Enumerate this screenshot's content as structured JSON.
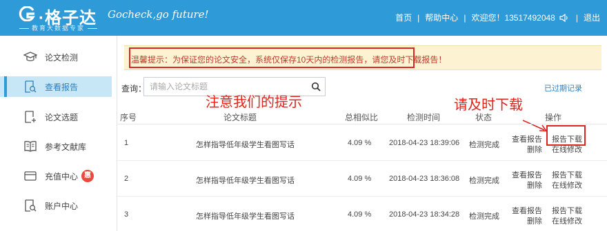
{
  "header": {
    "logo_text": "·格子达",
    "logo_subtitle": "教育大数据专家",
    "slogan": "Gocheck,go future!",
    "nav": {
      "home": "首页",
      "help": "帮助中心",
      "welcome": "欢迎您！13517492048",
      "logout": "退出"
    }
  },
  "sidebar": {
    "items": [
      {
        "label": "论文检测",
        "icon": "mortarboard-icon"
      },
      {
        "label": "查看报告",
        "icon": "report-search-icon",
        "active": true
      },
      {
        "label": "论文选题",
        "icon": "add-document-icon"
      },
      {
        "label": "参考文献库",
        "icon": "open-book-icon"
      },
      {
        "label": "充值中心",
        "icon": "card-icon",
        "badge": "惠"
      },
      {
        "label": "账户中心",
        "icon": "account-search-icon"
      }
    ]
  },
  "notice": {
    "text": "温馨提示：为保证您的论文安全，系统仅保存10天内的检测报告，请您及时下载报告！"
  },
  "search": {
    "label": "查询：",
    "placeholder": "请输入论文标题"
  },
  "expired_link": "已过期记录",
  "annotations": {
    "notice_hint": "注意我们的提示",
    "download_hint": "请及时下载"
  },
  "table": {
    "headers": [
      "序号",
      "论文标题",
      "总相似比",
      "检测时间",
      "状态",
      "操作"
    ],
    "rows": [
      {
        "no": "1",
        "title": "怎样指导低年级学生看图写话",
        "similarity": "4.09 %",
        "time": "2018-04-23 18:39:06",
        "status": "检测完成",
        "view": "查看报告",
        "delete": "删除",
        "download": "报告下载",
        "edit": "在线修改"
      },
      {
        "no": "2",
        "title": "怎样指导低年级学生看图写话",
        "similarity": "4.09 %",
        "time": "2018-04-23 18:36:08",
        "status": "检测完成",
        "view": "查看报告",
        "delete": "删除",
        "download": "报告下载",
        "edit": "在线修改"
      },
      {
        "no": "3",
        "title": "怎样指导低年级学生看图写话",
        "similarity": "4.09 %",
        "time": "2018-04-23 18:34:28",
        "status": "检测完成",
        "view": "查看报告",
        "delete": "删除",
        "download": "报告下载",
        "edit": "在线修改"
      }
    ]
  },
  "colors": {
    "header_blue": "#2f9ad8",
    "annotation_red": "#e0231b",
    "notice_bg": "#fdf3d2",
    "active_bg": "#c7e6f6",
    "badge_red": "#e84a3c",
    "link_blue": "#2f7fc1"
  }
}
